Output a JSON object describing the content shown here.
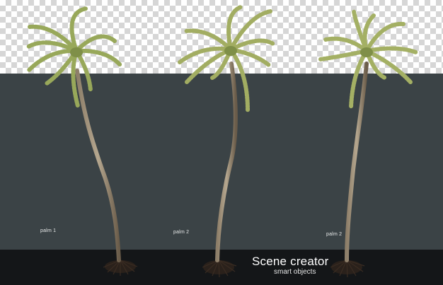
{
  "labels": [
    "palm 1",
    "palm 2",
    "palm 2"
  ],
  "brand": {
    "title": "Scene creator",
    "subtitle": "smart objects"
  },
  "colors": {
    "checker_light": "#ffffff",
    "checker_dark": "#d6d6d6",
    "panel": "#3b4346",
    "floor": "#141618",
    "frond": "#9aa85e",
    "trunk": "#7a6a55"
  }
}
